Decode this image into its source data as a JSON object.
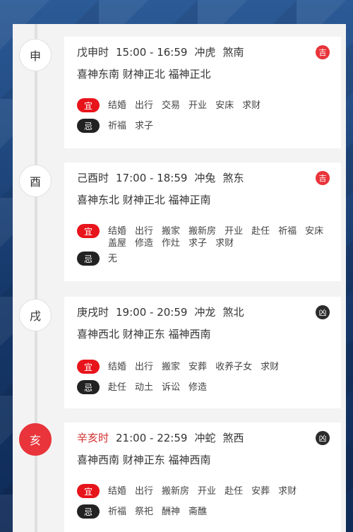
{
  "hours": [
    {
      "branch": "申",
      "name": "戊申时",
      "time": "15:00 - 16:59",
      "clash": "冲虎",
      "sha": "煞南",
      "gods": "喜神东南 财神正北 福神正北",
      "luck": "吉",
      "luck_type": "good",
      "active": false,
      "yi_label": "宜",
      "ji_label": "忌",
      "yi": [
        "结婚",
        "出行",
        "交易",
        "开业",
        "安床",
        "求财"
      ],
      "ji": [
        "祈福",
        "求子"
      ]
    },
    {
      "branch": "酉",
      "name": "己酉时",
      "time": "17:00 - 18:59",
      "clash": "冲兔",
      "sha": "煞东",
      "gods": "喜神东北 财神正北 福神正南",
      "luck": "吉",
      "luck_type": "good",
      "active": false,
      "yi_label": "宜",
      "ji_label": "忌",
      "yi": [
        "结婚",
        "出行",
        "搬家",
        "搬新房",
        "开业",
        "赴任",
        "祈福",
        "安床",
        "盖屋",
        "修造",
        "作灶",
        "求子",
        "求财"
      ],
      "ji": [
        "无"
      ]
    },
    {
      "branch": "戌",
      "name": "庚戌时",
      "time": "19:00 - 20:59",
      "clash": "冲龙",
      "sha": "煞北",
      "gods": "喜神西北 财神正东 福神西南",
      "luck": "凶",
      "luck_type": "bad",
      "active": false,
      "yi_label": "宜",
      "ji_label": "忌",
      "yi": [
        "结婚",
        "出行",
        "搬家",
        "安葬",
        "收养子女",
        "求财"
      ],
      "ji": [
        "赴任",
        "动土",
        "诉讼",
        "修造"
      ]
    },
    {
      "branch": "亥",
      "name": "辛亥时",
      "time": "21:00 - 22:59",
      "clash": "冲蛇",
      "sha": "煞西",
      "gods": "喜神西南 财神正东 福神西南",
      "luck": "凶",
      "luck_type": "bad",
      "active": true,
      "yi_label": "宜",
      "ji_label": "忌",
      "yi": [
        "结婚",
        "出行",
        "搬新房",
        "开业",
        "赴任",
        "安葬",
        "求财"
      ],
      "ji": [
        "祈福",
        "祭祀",
        "酬神",
        "斋醮"
      ]
    }
  ]
}
